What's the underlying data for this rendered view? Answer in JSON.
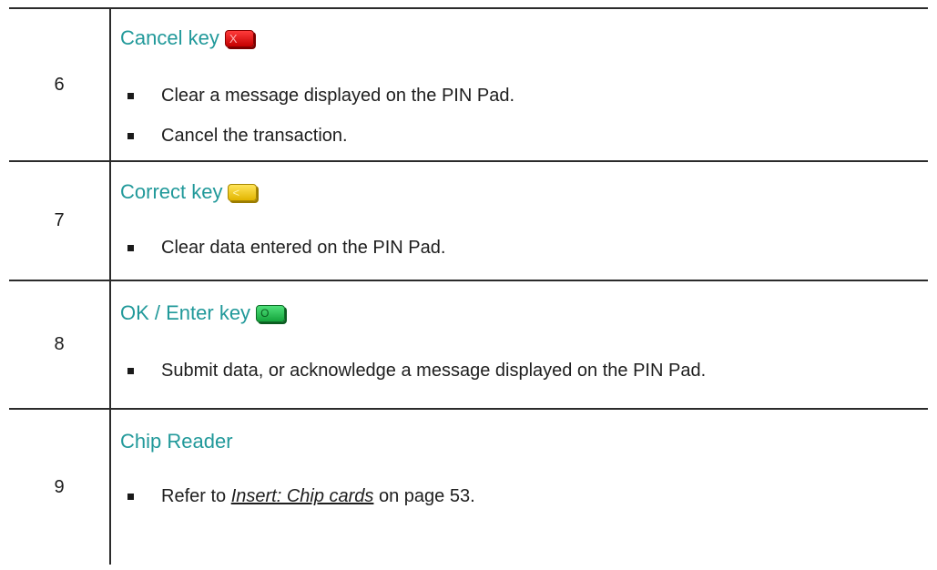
{
  "rows": [
    {
      "number": "6",
      "heading": "Cancel key",
      "icon": "cancel-key-icon",
      "key_color": "#e00000",
      "bullets": [
        "Clear a message displayed on the PIN Pad.",
        "Cancel the transaction."
      ]
    },
    {
      "number": "7",
      "heading": "Correct key",
      "icon": "correct-key-icon",
      "key_color": "#f0c800",
      "bullets": [
        "Clear data entered on the PIN Pad."
      ]
    },
    {
      "number": "8",
      "heading": "OK / Enter key",
      "icon": "enter-key-icon",
      "key_color": "#22b24a",
      "bullets": [
        "Submit data, or acknowledge a message displayed on the PIN Pad."
      ]
    },
    {
      "number": "9",
      "heading": "Chip Reader",
      "bullet_prefix": "Refer to ",
      "bullet_link": "Insert: Chip cards",
      "bullet_suffix": " on page 53."
    }
  ],
  "colors": {
    "heading": "#21999a",
    "rule": "#2b2b2b"
  }
}
